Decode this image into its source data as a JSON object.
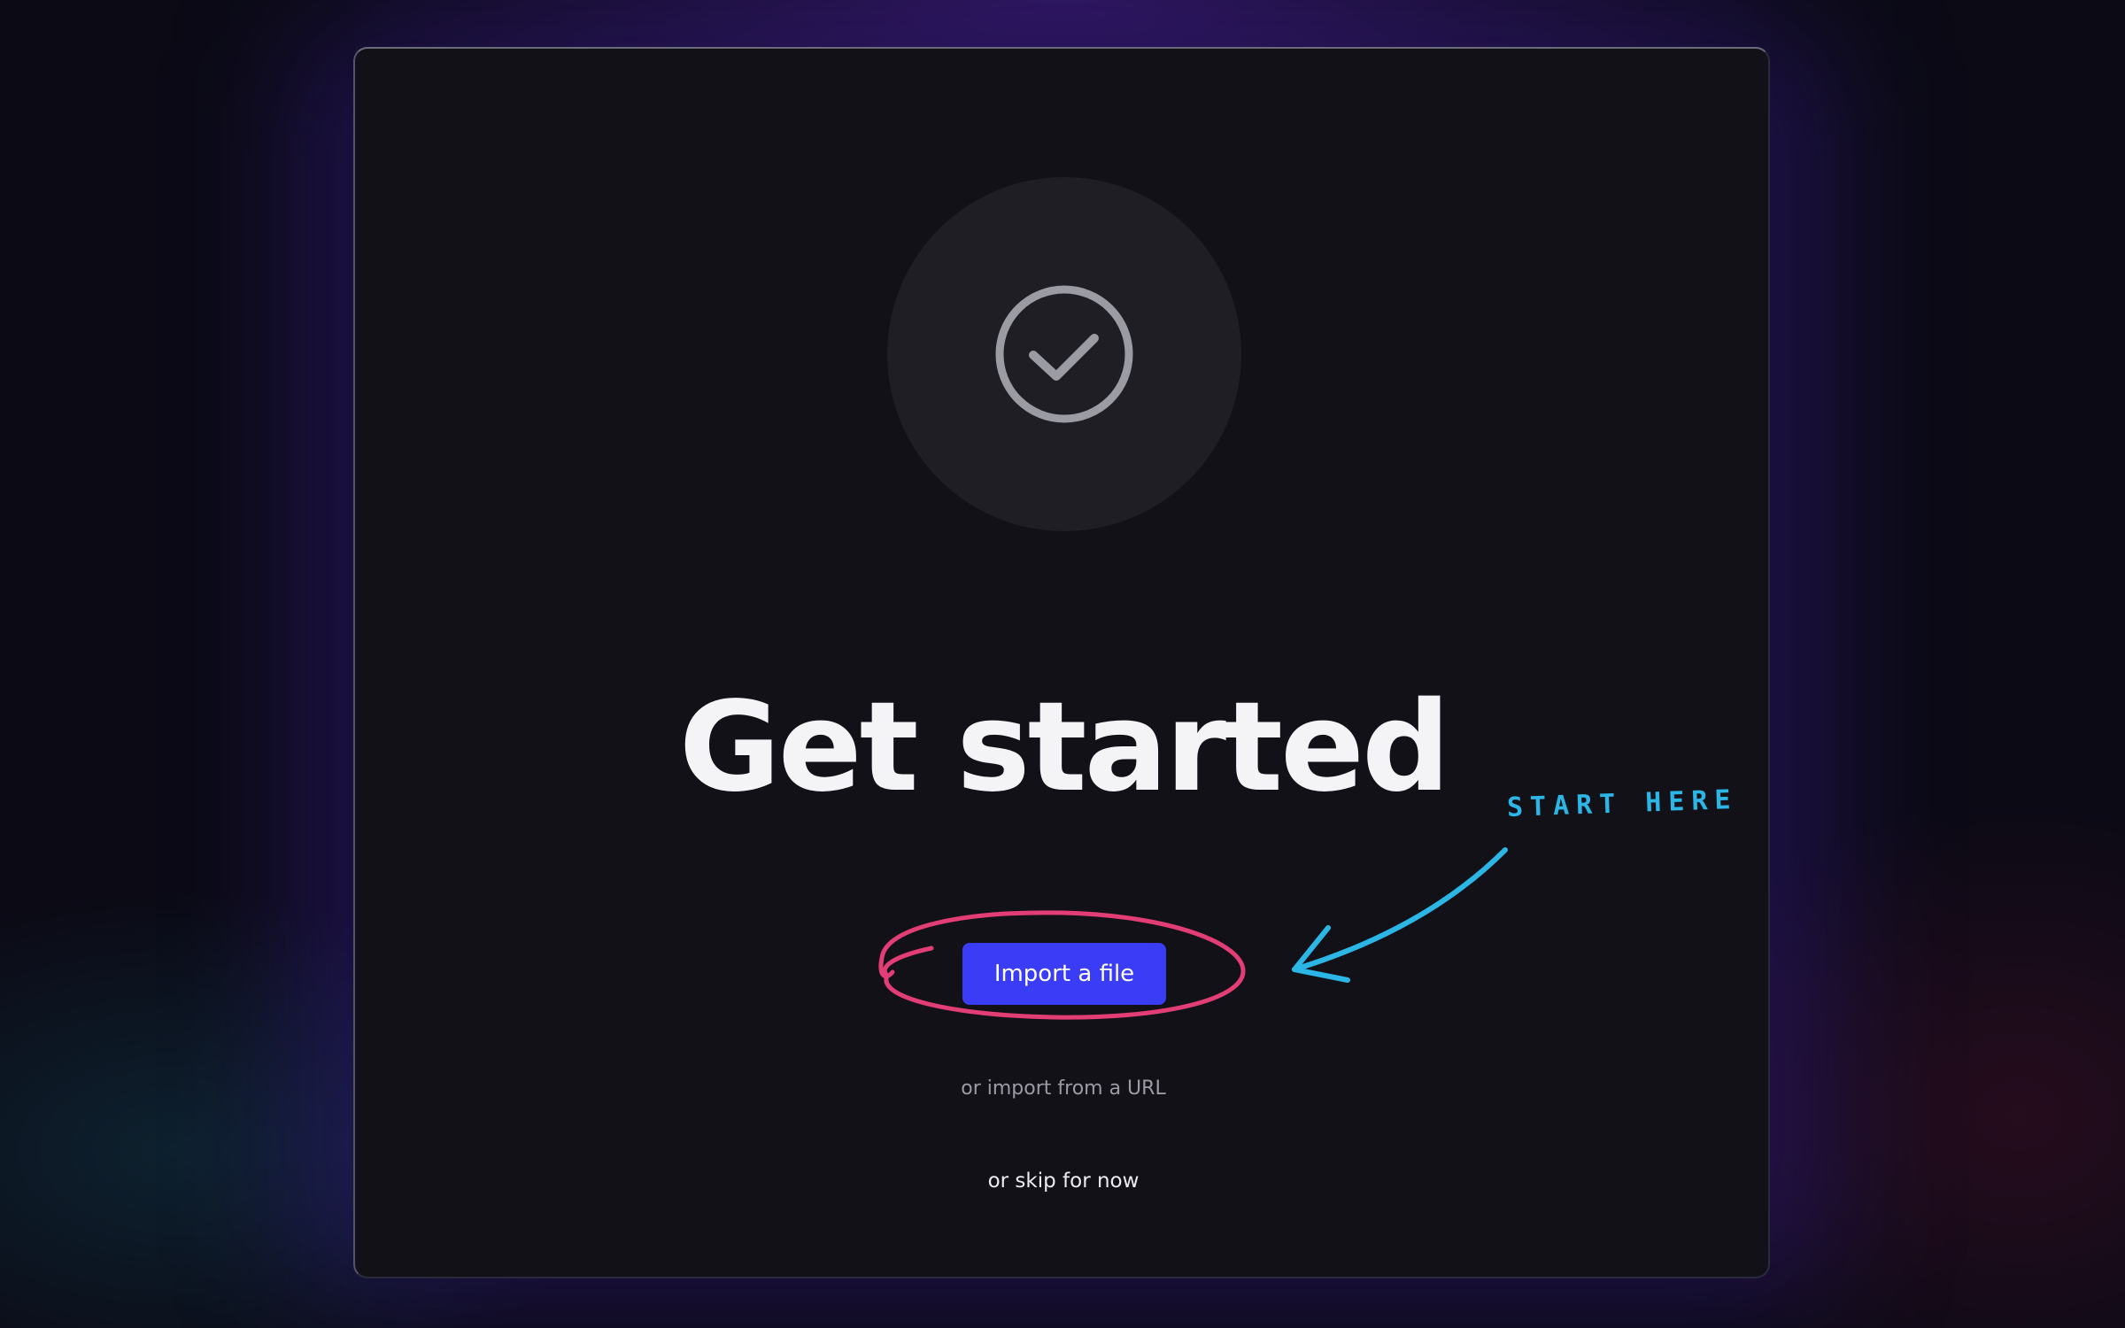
{
  "dialog": {
    "title": "Get started",
    "primary_button_label": "Import a file",
    "url_link_label": "or import from a URL",
    "skip_link_label": "or skip for now",
    "badge_icon": "check-circle-icon"
  },
  "annotation": {
    "label": "START HERE",
    "arrow_icon": "curved-arrow-icon",
    "highlight": "hand-drawn-circle"
  },
  "colors": {
    "primary_button": "#3b3cf5",
    "annotation_text": "#2bb6e6",
    "annotation_circle": "#e23d74",
    "card_background": "#121118"
  }
}
